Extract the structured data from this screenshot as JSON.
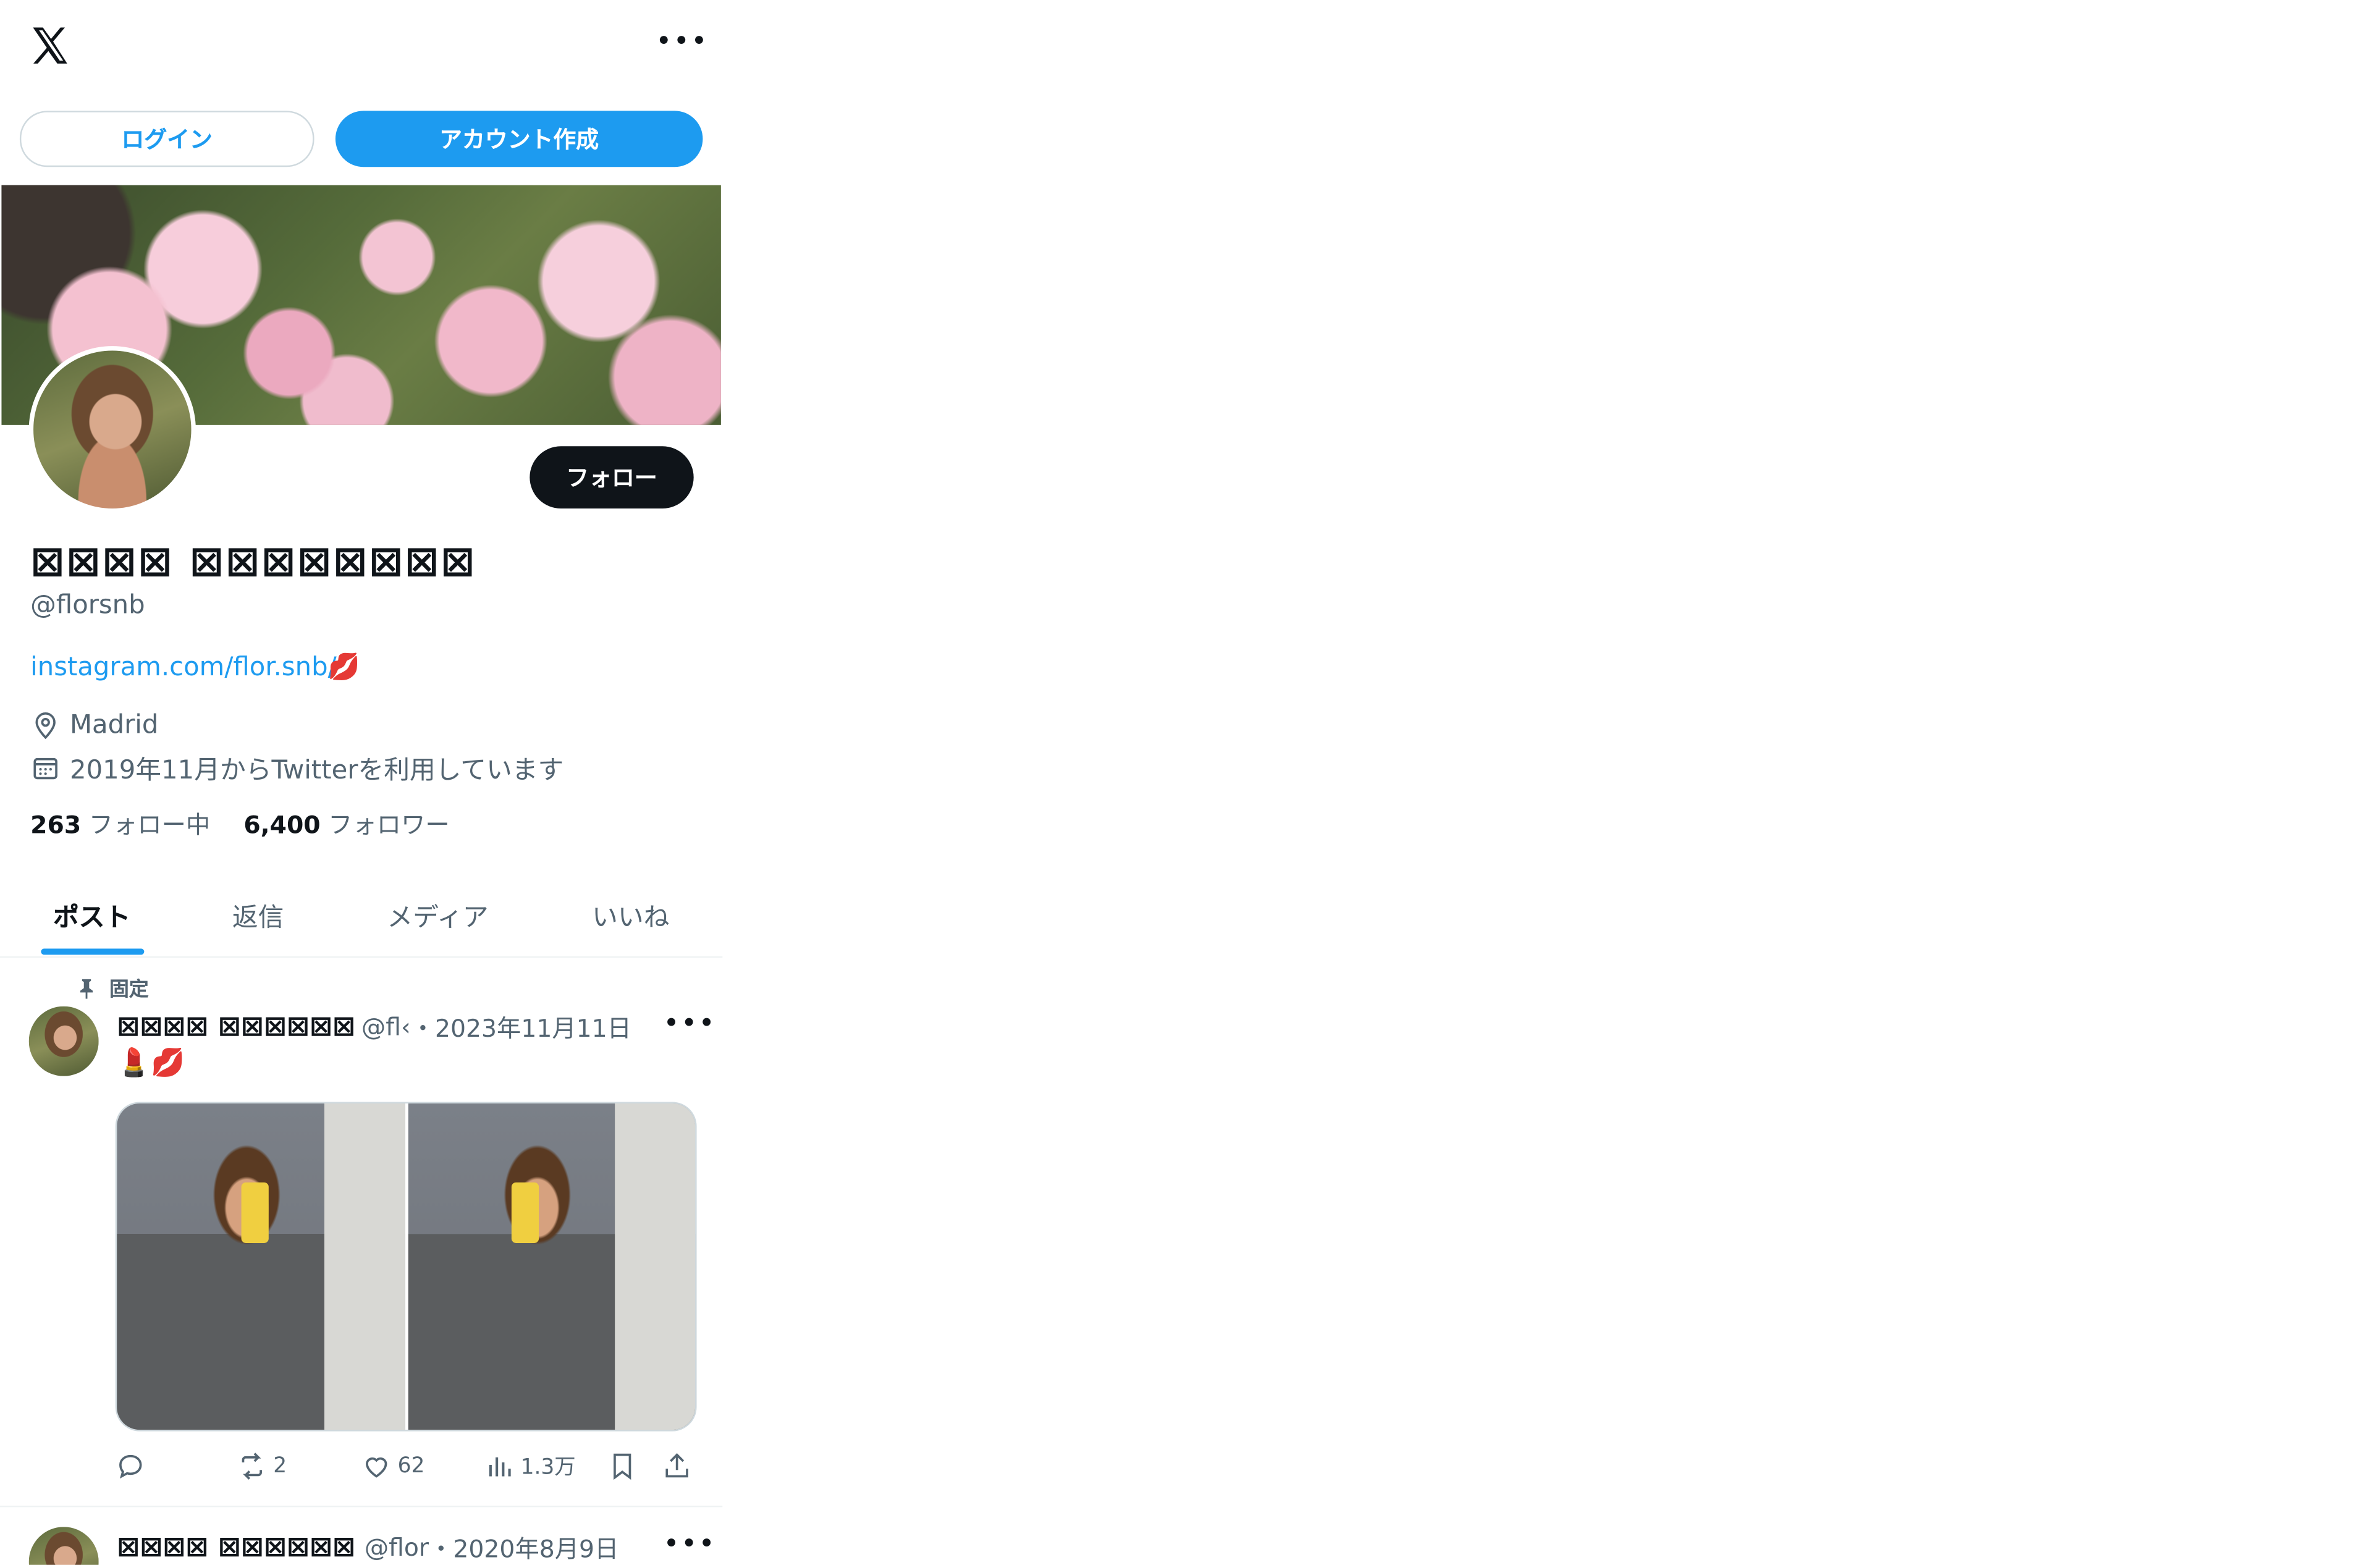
{
  "header": {
    "menu_icon": "more-horizontal-icon"
  },
  "auth": {
    "login_label": "ログイン",
    "signup_label": "アカウント作成"
  },
  "profile": {
    "display_name": "⊠⊠⊠⊠ ⊠⊠⊠⊠⊠⊠⊠⊠",
    "handle": "@florsnb",
    "link": "instagram.com/flor.snb/",
    "link_emoji": "💋",
    "location": "Madrid",
    "joined": "2019年11月からTwitterを利用しています",
    "following_count": "263",
    "following_label": "フォロー中",
    "followers_count": "6,400",
    "followers_label": "フォロワー",
    "follow_label": "フォロー"
  },
  "tabs": [
    {
      "label": "ポスト",
      "active": true
    },
    {
      "label": "返信",
      "active": false
    },
    {
      "label": "メディア",
      "active": false
    },
    {
      "label": "いいね",
      "active": false
    }
  ],
  "posts": [
    {
      "pinned_label": "固定",
      "name": "⊠⊠⊠⊠ ⊠⊠⊠⊠⊠⊠",
      "handle": "@fl‹",
      "date": "・2023年11月11日",
      "text": "💄💋",
      "retweets": "2",
      "likes": "62",
      "views": "1.3万"
    },
    {
      "name": "⊠⊠⊠⊠ ⊠⊠⊠⊠⊠⊠",
      "handle": "@flor",
      "date": "・2020年8月9日"
    }
  ],
  "colors": {
    "accent": "#1d9bf0",
    "text": "#0f1419",
    "muted": "#536471",
    "follow_bg": "#0f1419"
  }
}
